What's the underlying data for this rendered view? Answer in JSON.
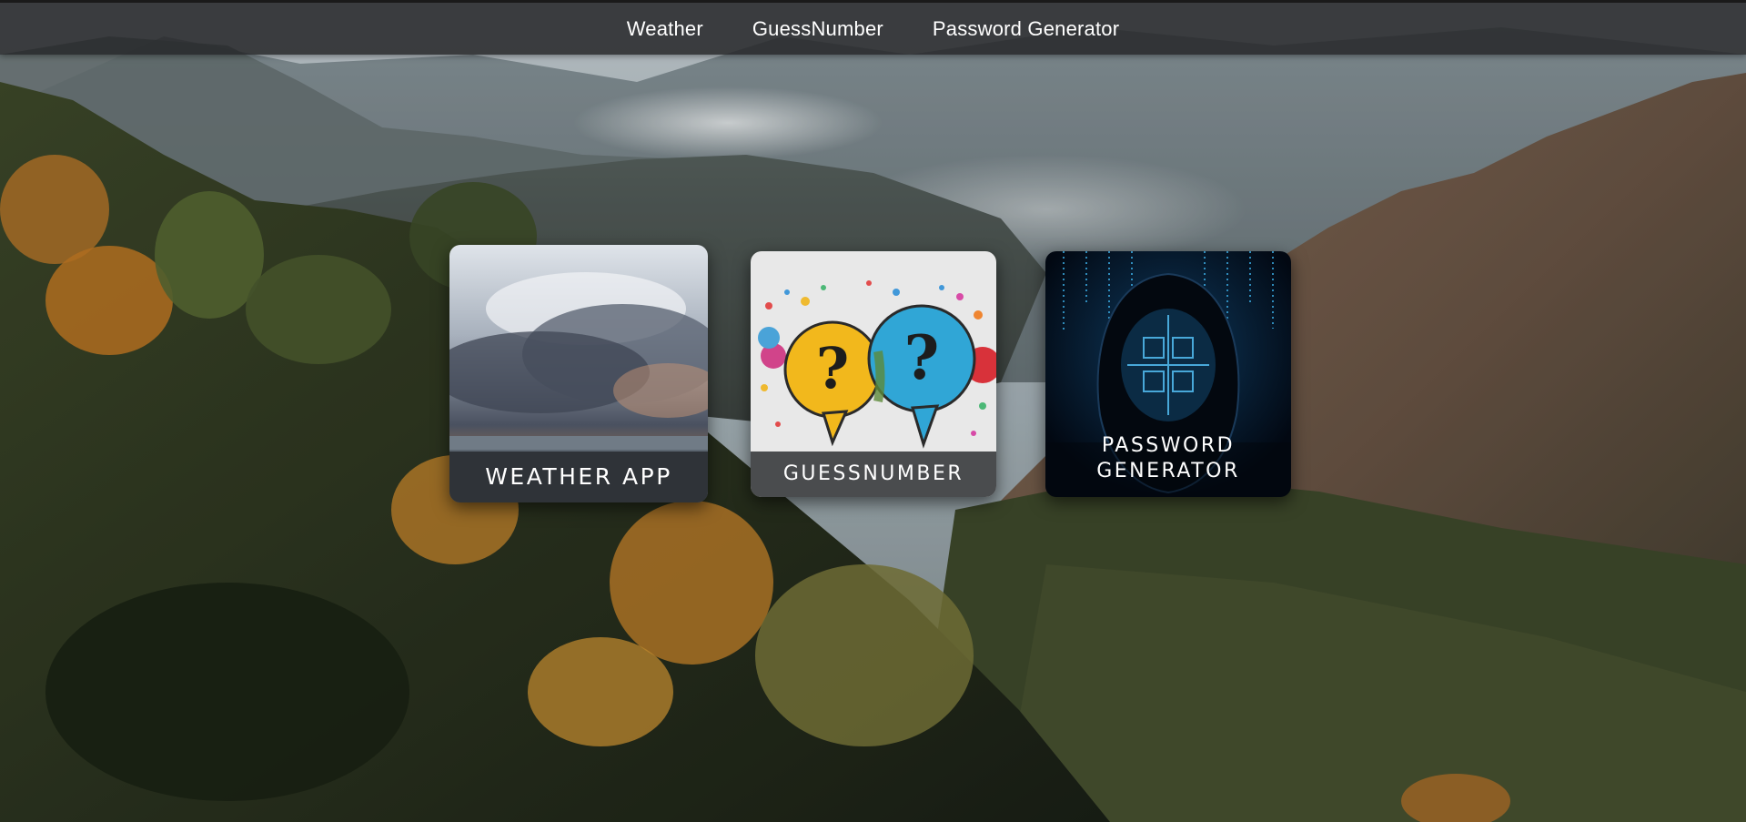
{
  "nav": {
    "links": [
      {
        "label": "Weather"
      },
      {
        "label": "GuessNumber"
      },
      {
        "label": "Password Generator"
      }
    ]
  },
  "cards": {
    "weather": {
      "caption": "WEATHER APP"
    },
    "guess": {
      "caption": "GUESSNUMBER"
    },
    "password": {
      "caption": "PASSWORD\nGENERATOR"
    }
  }
}
